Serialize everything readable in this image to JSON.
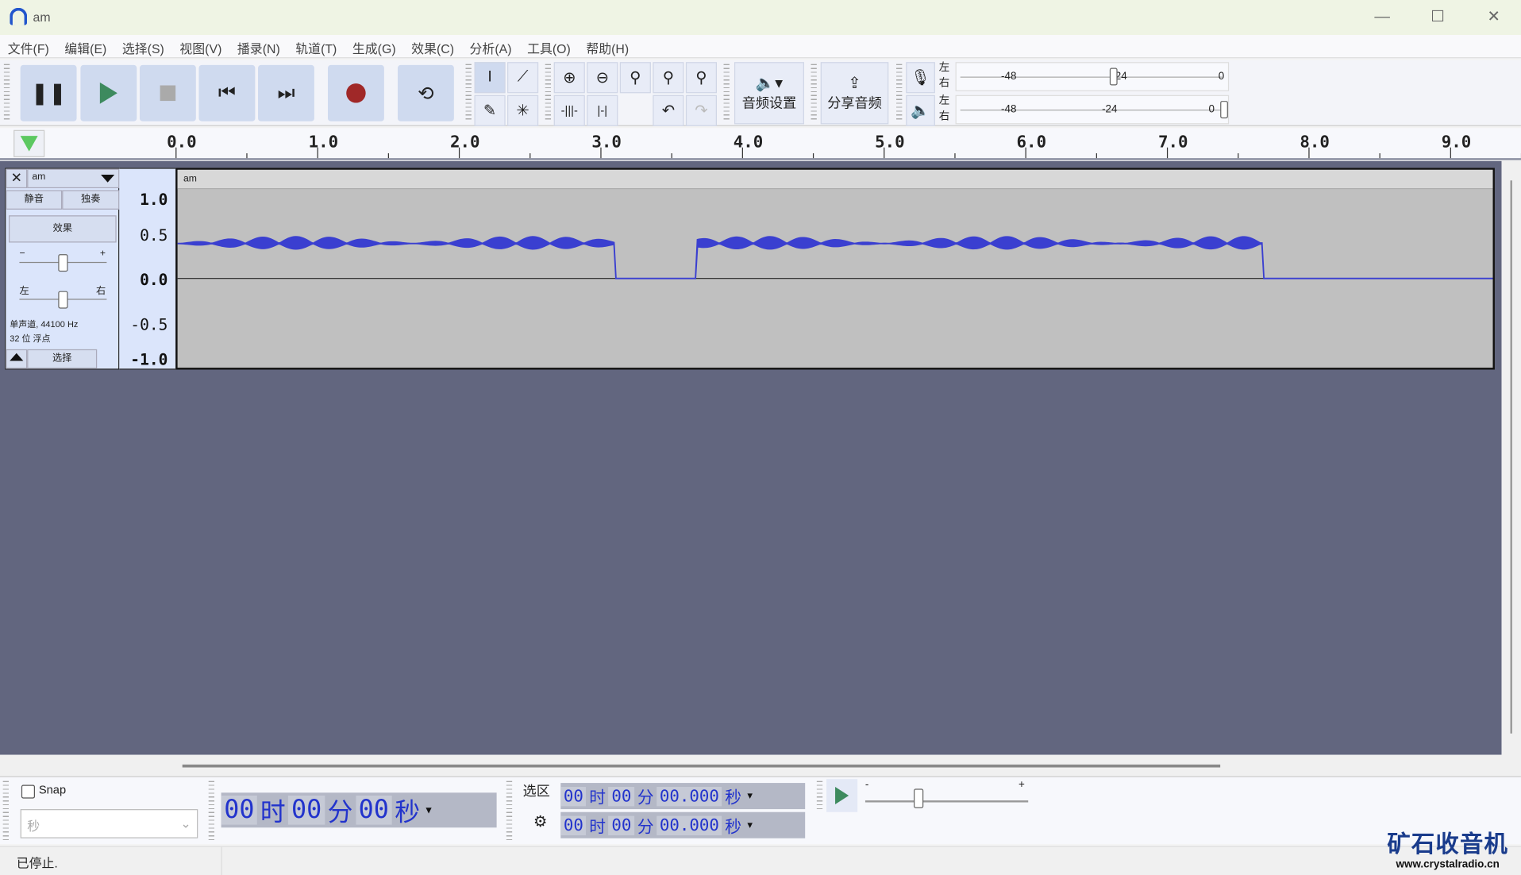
{
  "window": {
    "title": "am",
    "minimize": "—",
    "maximize": "☐",
    "close": "✕"
  },
  "menu": [
    "文件(F)",
    "编辑(E)",
    "选择(S)",
    "视图(V)",
    "播录(N)",
    "轨道(T)",
    "生成(G)",
    "效果(C)",
    "分析(A)",
    "工具(O)",
    "帮助(H)"
  ],
  "toolbar": {
    "audio_setup": "音频设置",
    "share_audio": "分享音频",
    "meter": {
      "left": "左",
      "right": "右",
      "rec_labels": [
        "-48",
        "-24",
        "0"
      ],
      "play_labels": [
        "-48",
        "-24",
        "0"
      ]
    }
  },
  "ruler": {
    "labels": [
      "0.0",
      "1.0",
      "2.0",
      "3.0",
      "4.0",
      "5.0",
      "6.0",
      "7.0",
      "8.0",
      "9.0"
    ]
  },
  "track": {
    "name": "am",
    "clip_name": "am",
    "mute": "静音",
    "solo": "独奏",
    "effects": "效果",
    "gain_minus": "−",
    "gain_plus": "+",
    "pan_left": "左",
    "pan_right": "右",
    "info1": "单声道, 44100 Hz",
    "info2": "32 位 浮点",
    "select": "选择",
    "vruler": [
      "1.0",
      "0.5",
      "0.0",
      "-0.5",
      "-1.0"
    ]
  },
  "bottom": {
    "snap": "Snap",
    "unit": "秒",
    "time": [
      "00",
      "时",
      "00",
      "分",
      "00",
      "秒"
    ],
    "selection_label": "选区",
    "sel_start": [
      "00",
      "时",
      "00",
      "分",
      "00.000",
      "秒"
    ],
    "sel_end": [
      "00",
      "时",
      "00",
      "分",
      "00.000",
      "秒"
    ],
    "speed_minus": "-",
    "speed_plus": "+"
  },
  "status": "已停止.",
  "watermark": {
    "title": "矿石收音机",
    "url": "www.crystalradio.cn"
  },
  "colors": {
    "wave": "#3a3fd0",
    "record": "#a02828",
    "play": "#3d8a5e",
    "canvas": "#62667f"
  }
}
